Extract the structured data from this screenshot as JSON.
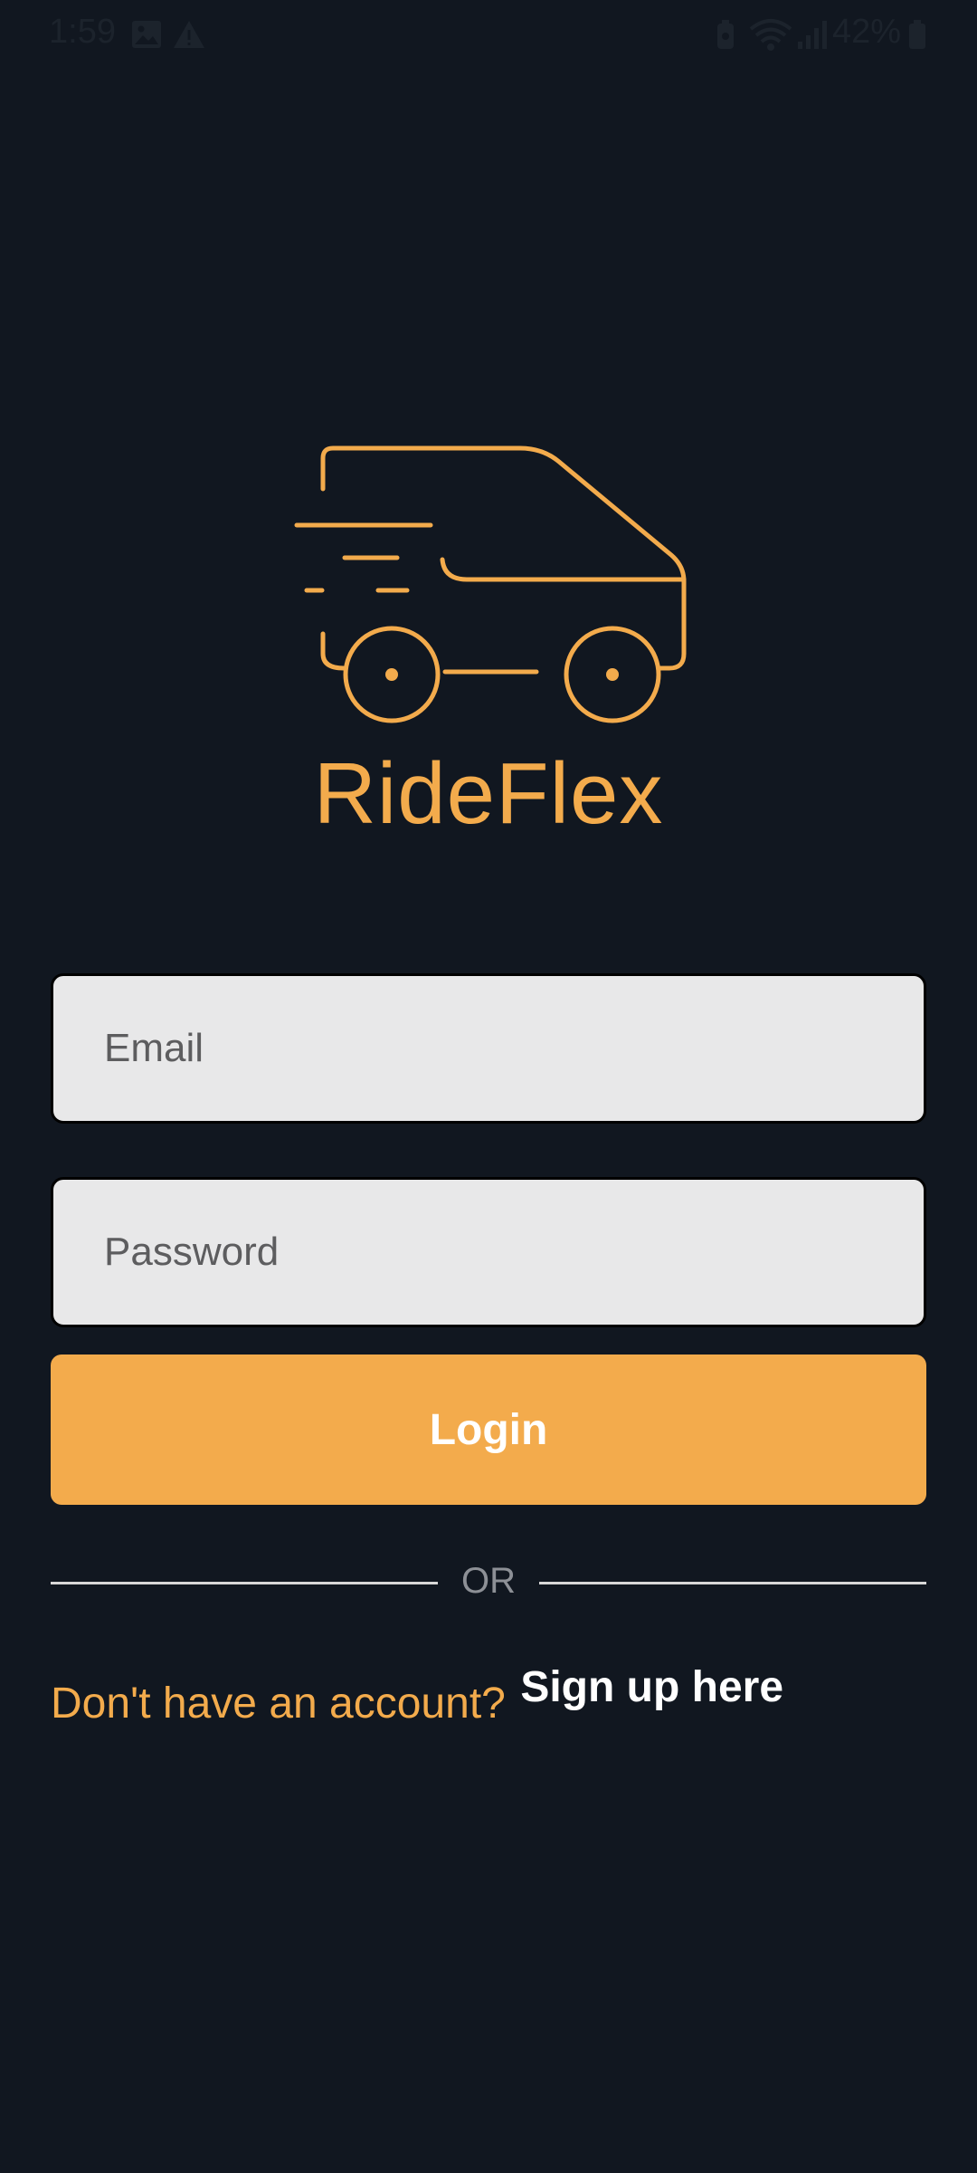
{
  "status_bar": {
    "time": "1:59",
    "battery": "42%",
    "icons": [
      "image-icon",
      "warning-icon",
      "battery-saver-icon",
      "wifi-icon",
      "signal-icon",
      "battery-icon"
    ]
  },
  "brand": {
    "name": "RideFlex",
    "logo_icon": "van-icon",
    "accent_color": "#f3ab4c",
    "background_color": "#111720"
  },
  "login_form": {
    "email_placeholder": "Email",
    "email_value": "",
    "password_placeholder": "Password",
    "password_value": "",
    "login_label": "Login"
  },
  "divider": {
    "label": "OR"
  },
  "signup": {
    "prompt": "Don't have an account?",
    "link_label": "Sign up here"
  }
}
